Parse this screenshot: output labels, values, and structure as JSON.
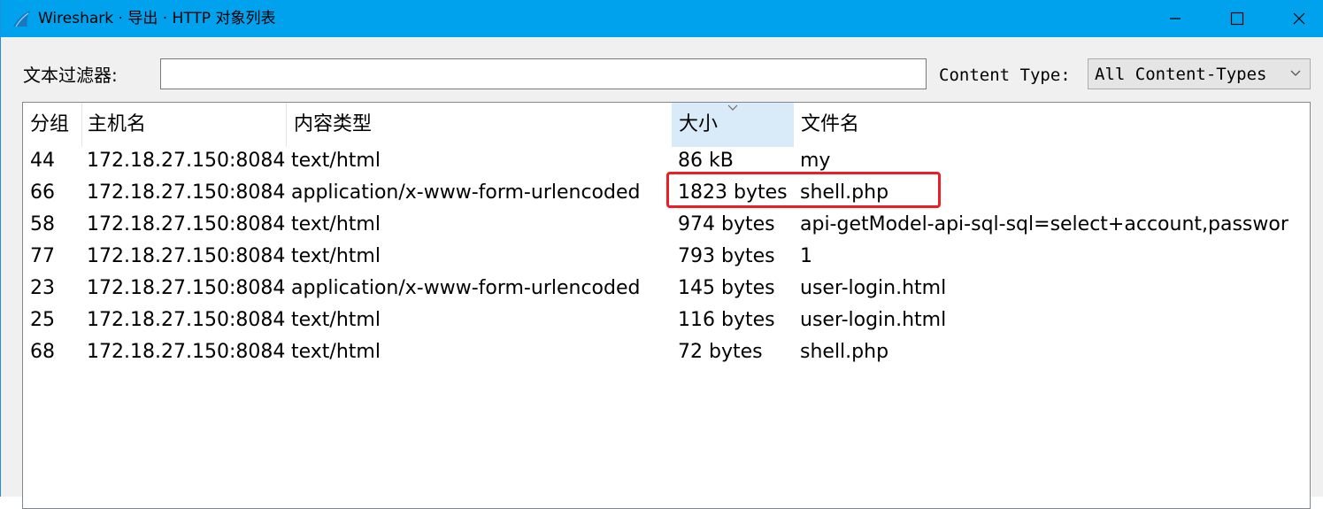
{
  "window": {
    "title": "Wireshark · 导出 · HTTP 对象列表",
    "icons": {
      "app": "wireshark-fin-icon",
      "minimize": "minimize-icon",
      "maximize": "maximize-icon",
      "close": "close-icon"
    },
    "titlebar_color": "#00a2ed"
  },
  "filter": {
    "label": "文本过滤器:",
    "value": "",
    "content_type_label": "Content Type:",
    "content_type_selected": "All Content-Types"
  },
  "table": {
    "columns": [
      "分组",
      "主机名",
      "内容类型",
      "大小",
      "文件名"
    ],
    "sorted_column": "大小",
    "sort_direction": "descending",
    "rows": [
      [
        "44",
        "172.18.27.150:8084",
        "text/html",
        "86 kB",
        "my"
      ],
      [
        "66",
        "172.18.27.150:8084",
        "application/x-www-form-urlencoded",
        "1823 bytes",
        "shell.php"
      ],
      [
        "58",
        "172.18.27.150:8084",
        "text/html",
        "974 bytes",
        "api-getModel-api-sql-sql=select+account,passwor"
      ],
      [
        "77",
        "172.18.27.150:8084",
        "text/html",
        "793 bytes",
        "1"
      ],
      [
        "23",
        "172.18.27.150:8084",
        "application/x-www-form-urlencoded",
        "145 bytes",
        "user-login.html"
      ],
      [
        "25",
        "172.18.27.150:8084",
        "text/html",
        "116 bytes",
        "user-login.html"
      ],
      [
        "68",
        "172.18.27.150:8084",
        "text/html",
        "72 bytes",
        "shell.php"
      ]
    ]
  },
  "annotation": {
    "highlighted_row_packet": "66",
    "color": "#ee1c24"
  }
}
